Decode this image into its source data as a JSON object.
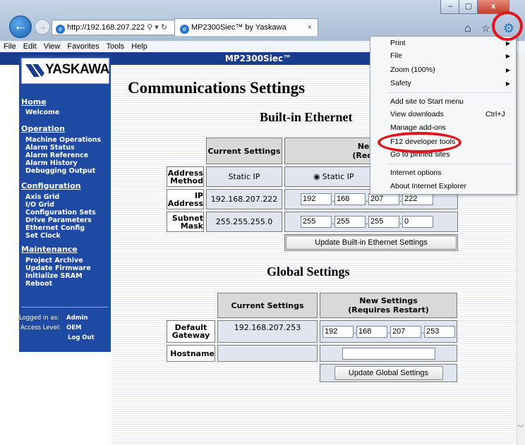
{
  "browser": {
    "address": "http://192.168.207.222",
    "address_controls": "⚲ ▾ ↻",
    "tab_title": "MP2300Siec™ by Yaskawa",
    "tab_close": "×",
    "window_controls": {
      "minimize": "–",
      "maximize": "▢",
      "close": "x"
    },
    "icons": {
      "back": "←",
      "forward": "→",
      "home": "⌂",
      "favorites": "☆",
      "tools": "⚙"
    }
  },
  "menubar": [
    "File",
    "Edit",
    "View",
    "Favorites",
    "Tools",
    "Help"
  ],
  "page": {
    "header": "MP2300Siec™",
    "logo_text": "YASKAWA",
    "title": "Communications Settings",
    "sidebar": {
      "sections": [
        {
          "title": "Home",
          "items": [
            "Welcome"
          ]
        },
        {
          "title": "Operation",
          "items": [
            "Machine Operations",
            "Alarm Status",
            "Alarm Reference",
            "Alarm History",
            "Debugging Output"
          ]
        },
        {
          "title": "Configuration",
          "items": [
            "Axis Grid",
            "I/O Grid",
            "Configuration Sets",
            "Drive Parameters",
            "Ethernet Config",
            "Set Clock"
          ]
        },
        {
          "title": "Maintenance",
          "items": [
            "Project Archive",
            "Update Firmware",
            "Initialize SRAM",
            "Reboot"
          ]
        }
      ],
      "logged_in_label": "Logged in as:",
      "logged_in_user": "Admin",
      "access_label": "Access Level:",
      "access_level": "OEM",
      "logout": "Log Out"
    },
    "ethernet": {
      "heading": "Built-in Ethernet",
      "col_current": "Current Settings",
      "col_new_line1": "New S",
      "col_new_line2": "(Require",
      "rows": [
        {
          "label": "Address Method",
          "current": "Static IP",
          "new_radio": "Static IP"
        },
        {
          "label": "IP Address",
          "current": "192.168.207.222",
          "octets": [
            "192",
            "168",
            "207",
            "222"
          ]
        },
        {
          "label": "Subnet Mask",
          "current": "255.255.255.0",
          "octets": [
            "255",
            "255",
            "255",
            "0"
          ]
        }
      ],
      "update_button": "Update Built-in Ethernet Settings"
    },
    "global": {
      "heading": "Global Settings",
      "col_current": "Current Settings",
      "col_new_line1": "New Settings",
      "col_new_line2": "(Requires Restart)",
      "gateway_label": "Default Gateway",
      "gateway_current": "192.168.207.253",
      "gateway_octets": [
        "192",
        "168",
        "207",
        "253"
      ],
      "hostname_label": "Hostname",
      "hostname_value": "",
      "update_button": "Update Global Settings"
    }
  },
  "tools_menu": {
    "items": [
      {
        "label": "Print",
        "submenu": true
      },
      {
        "label": "File",
        "submenu": true
      },
      {
        "label": "Zoom (100%)",
        "submenu": true
      },
      {
        "label": "Safety",
        "submenu": true
      },
      {
        "label": "Add site to Start menu"
      },
      {
        "label": "View downloads",
        "shortcut": "Ctrl+J"
      },
      {
        "label": "Manage add-ons"
      },
      {
        "label": "F12 developer tools"
      },
      {
        "label": "Go to pinned sites"
      },
      {
        "label": "Internet options"
      },
      {
        "label": "About Internet Explorer"
      }
    ]
  },
  "annotation_color": "#e0141d"
}
